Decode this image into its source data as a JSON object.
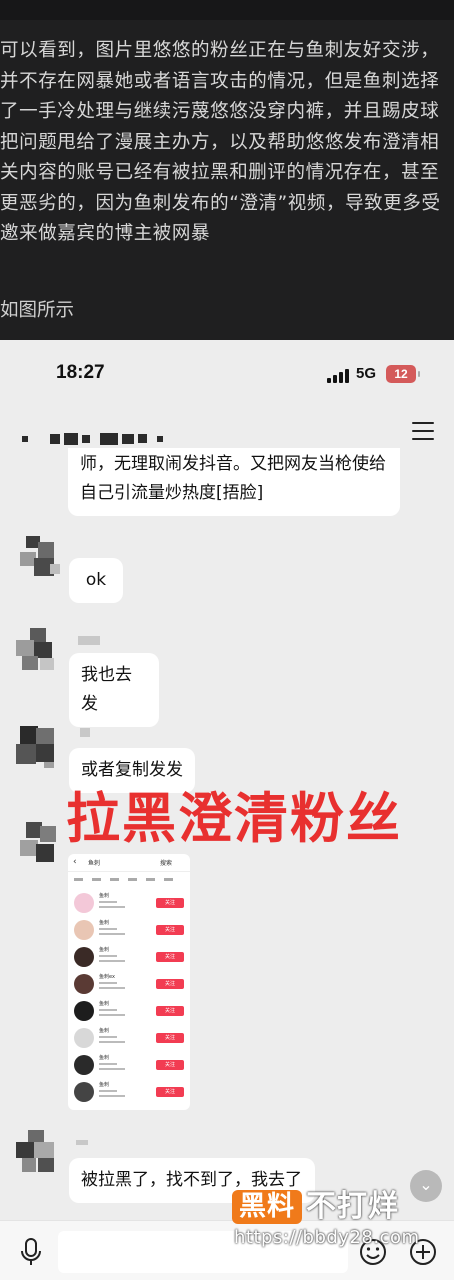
{
  "post": {
    "paragraph": "可以看到，图片里悠悠的粉丝正在与鱼刺友好交涉，并不存在网暴她或者语言攻击的情况，但是鱼刺选择了一手冷处理与继续污蔑悠悠没穿内裤，并且踢皮球把问题甩给了漫展主办方，以及帮助悠悠发布澄清相关内容的账号已经有被拉黑和删评的情况存在，甚至更恶劣的，因为鱼刺发布的“澄清”视频，导致更多受邀来做嘉宾的博主被网暴",
    "caption": "如图所示"
  },
  "status_bar": {
    "time": "18:27",
    "network": "5G",
    "battery": "12"
  },
  "chat": {
    "messages": [
      {
        "text": "师，无理取闹发抖音。又把网友当枪使给自己引流量炒热度[捂脸]"
      },
      {
        "text": "ok"
      },
      {
        "text": "我也去发"
      },
      {
        "text": "或者复制发发"
      },
      {
        "text": "被拉黑了，找不到了，我去了"
      }
    ],
    "overlay_caption": "拉黑澄清粉丝"
  },
  "embedded_screenshot": {
    "title": "鱼刺",
    "header_right": "搜索",
    "rows": [
      {
        "name": "鱼刺",
        "button": "关注",
        "avatar_color": "#f3c8d8"
      },
      {
        "name": "鱼刺",
        "button": "关注",
        "avatar_color": "#e9c6b4"
      },
      {
        "name": "鱼刺",
        "button": "关注",
        "avatar_color": "#3a2a26"
      },
      {
        "name": "鱼刺ex",
        "button": "关注",
        "avatar_color": "#5a3a34"
      },
      {
        "name": "鱼刺",
        "button": "关注",
        "avatar_color": "#1d1d1d"
      },
      {
        "name": "鱼刺",
        "button": "关注",
        "avatar_color": "#d8d8d8"
      },
      {
        "name": "鱼刺",
        "button": "关注",
        "avatar_color": "#2a2a2a"
      },
      {
        "name": "鱼刺",
        "button": "关注",
        "avatar_color": "#444444"
      }
    ]
  },
  "watermark": {
    "badge": "黑料",
    "text": "不打烊",
    "url": "https://bbdy28.com"
  },
  "icons": {
    "menu": "menu-icon",
    "scroll": "chevron-down-icon",
    "voice": "microphone-icon",
    "emoji": "emoji-icon",
    "plus": "plus-circle-icon"
  },
  "colors": {
    "overlay_red": "#e8302f",
    "follow_button": "#f23c52",
    "watermark_orange": "#f07a1a"
  }
}
